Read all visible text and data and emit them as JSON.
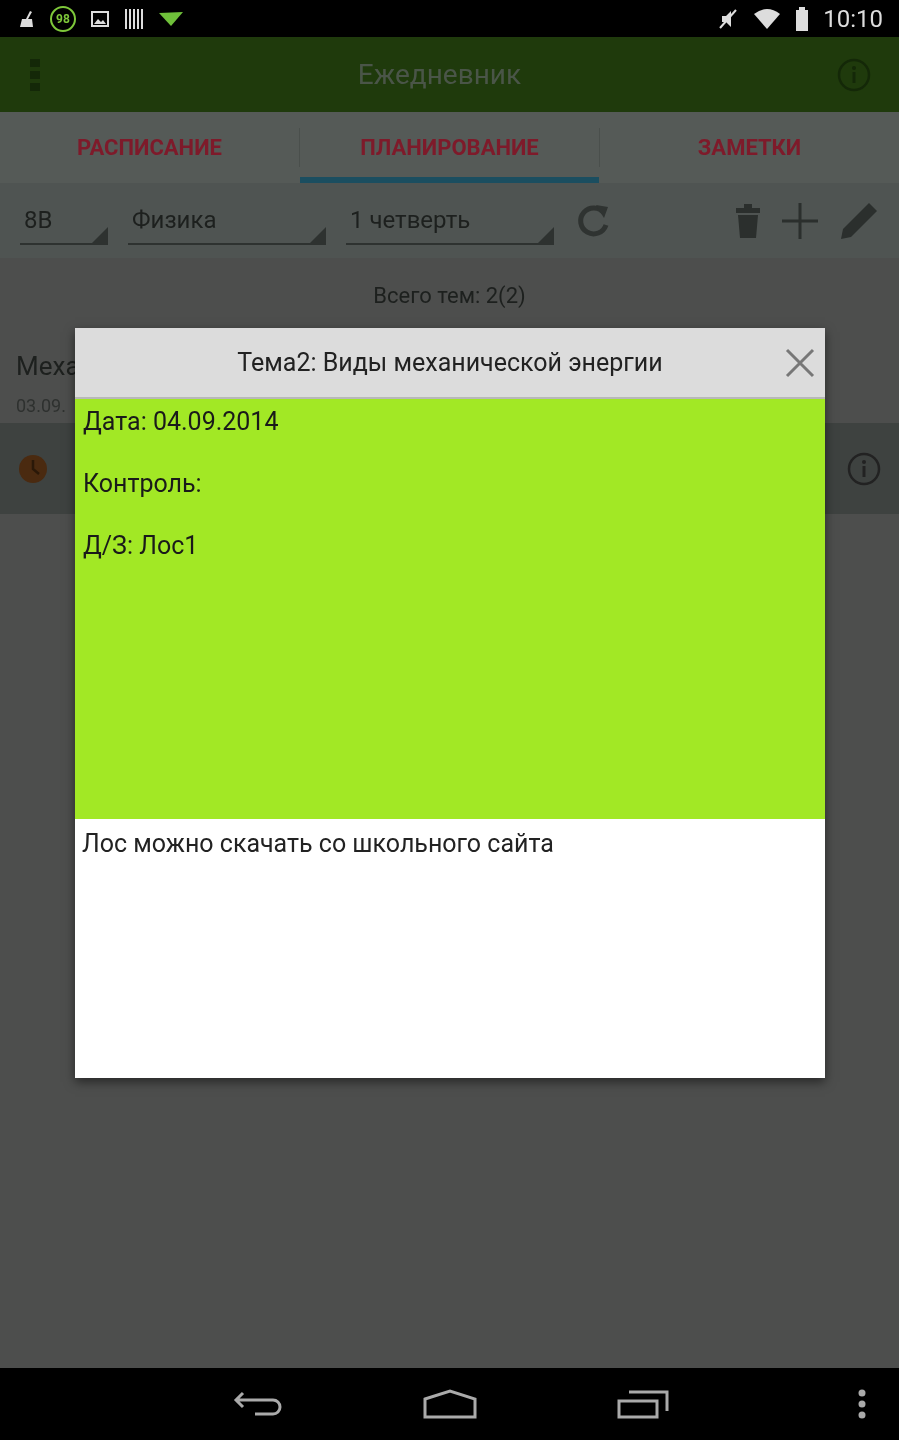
{
  "status_bar": {
    "battery_badge": "98",
    "time": "10:10"
  },
  "app_bar": {
    "title": "Ежедневник"
  },
  "tabs": [
    {
      "label": "РАСПИСАНИЕ",
      "selected": false
    },
    {
      "label": "ПЛАНИРОВАНИЕ",
      "selected": true
    },
    {
      "label": "ЗАМЕТКИ",
      "selected": false
    }
  ],
  "filters": [
    {
      "value": "8В"
    },
    {
      "value": "Физика"
    },
    {
      "value": "1 четверть"
    }
  ],
  "summary": "Всего тем: 2(2)",
  "topic": {
    "title": "Меха",
    "date": "03.09."
  },
  "dialog": {
    "title": "Тема2: Виды механической энергии",
    "lines": [
      "Дата: 04.09.2014",
      "Контроль:",
      "Д/З: Лос1"
    ],
    "note": "Лос можно скачать со школьного сайта"
  }
}
